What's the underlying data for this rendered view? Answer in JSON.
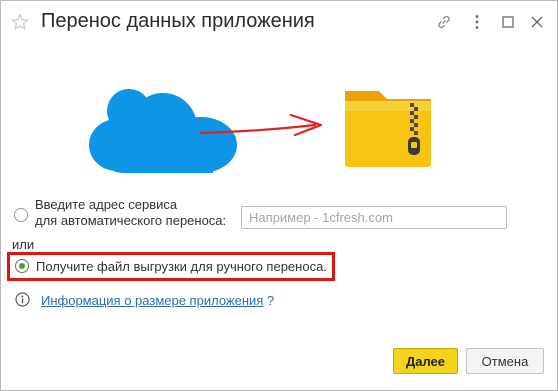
{
  "window": {
    "title": "Перенос данных приложения"
  },
  "icons": {
    "favorite": "star-icon",
    "link": "link-icon",
    "more": "more-icon",
    "maximize": "maximize-icon",
    "close": "close-icon",
    "cloud": "cloud-icon",
    "archive": "zip-folder-icon",
    "info": "info-icon"
  },
  "options": {
    "auto": {
      "line1": "Введите адрес сервиса",
      "line2": "для автоматического переноса:",
      "checked": false,
      "input_placeholder": "Например - 1cfresh.com",
      "input_value": ""
    },
    "or_label": "или",
    "manual": {
      "label": "Получите файл выгрузки для ручного переноса.",
      "checked": true
    }
  },
  "info": {
    "link_text": "Информация о размере приложения",
    "help_text": "?"
  },
  "buttons": {
    "next": "Далее",
    "cancel": "Отмена"
  },
  "colors": {
    "cloud": "#0f95e6",
    "arrow": "#e32222",
    "folder": "#f5b80e",
    "highlight_border": "#e01515",
    "primary_button": "#f4d41b",
    "link": "#2c6db3"
  }
}
